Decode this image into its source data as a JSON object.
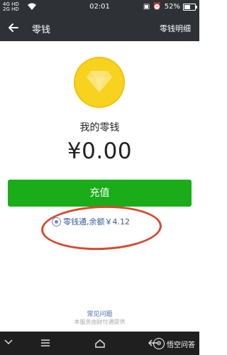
{
  "status_bar": {
    "signal_text": "4G HD\n2G HD",
    "time": "02:01",
    "battery": "52%",
    "battery_level": 0.52
  },
  "header": {
    "title": "零钱",
    "detail_link": "零钱明细"
  },
  "wallet": {
    "label": "我的零钱",
    "balance": "¥0.00",
    "recharge_button": "充值",
    "lingqiantong_text": "零钱通,余额￥4.12"
  },
  "footer": {
    "faq": "常见问题",
    "provider": "本服务由财付通提供"
  },
  "watermark": {
    "logo": "⊕",
    "text": "悟空问答"
  },
  "colors": {
    "bar_bg": "#2e3135",
    "accent_green": "#1aad19",
    "coin": "#f7d21f",
    "link": "#3a5a94",
    "annotation": "#d64a2f"
  }
}
